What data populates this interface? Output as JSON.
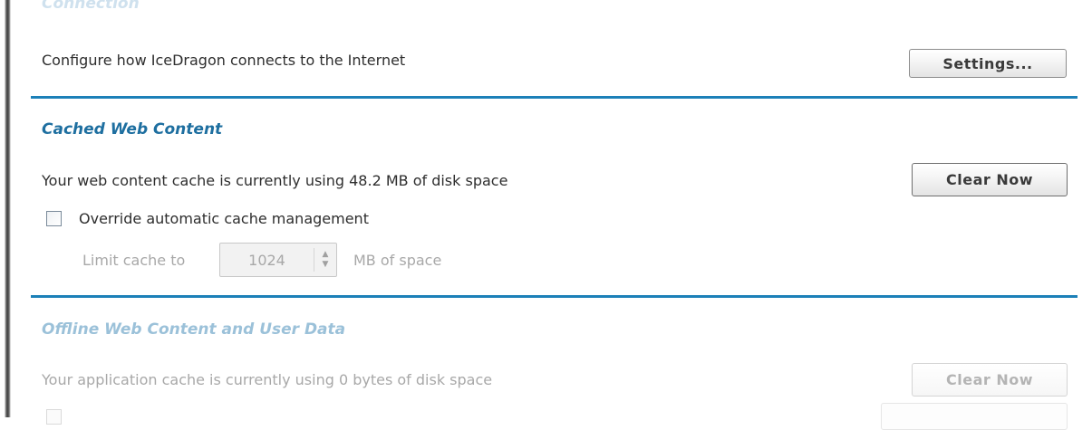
{
  "connection": {
    "title": "Connection",
    "description": "Configure how IceDragon connects to the Internet",
    "settings_button": "Settings..."
  },
  "cached_content": {
    "title": "Cached Web Content",
    "status": "Your web content cache is currently using 48.2 MB of disk space",
    "clear_button": "Clear Now",
    "override_label": "Override automatic cache management",
    "override_checked": false,
    "limit_label": "Limit cache to",
    "limit_value": "1024",
    "limit_unit": "MB of space"
  },
  "offline_content": {
    "title": "Offline Web Content and User Data",
    "status": "Your application cache is currently using 0 bytes of disk space",
    "clear_button": "Clear Now"
  },
  "colors": {
    "accent": "#1c80b8",
    "section_title": "#1e6fa0"
  }
}
